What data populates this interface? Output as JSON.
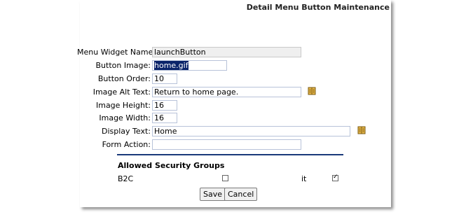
{
  "page_title": "Detail Menu Button Maintenance",
  "fields": {
    "menu_widget_name": {
      "label": "Menu Widget Name:",
      "value": "launchButton"
    },
    "button_image": {
      "label": "Button Image:",
      "value": "home.gif"
    },
    "button_order": {
      "label": "Button Order:",
      "value": "10"
    },
    "image_alt_text": {
      "label": "Image Alt Text:",
      "value": "Return to home page."
    },
    "image_height": {
      "label": "Image Height:",
      "value": "16"
    },
    "image_width": {
      "label": "Image Width:",
      "value": "16"
    },
    "display_text": {
      "label": "Display Text:",
      "value": "Home"
    },
    "form_action": {
      "label": "Form Action:",
      "value": ""
    }
  },
  "security": {
    "heading": "Allowed Security Groups",
    "groups": [
      {
        "name": "B2C",
        "checked": false
      },
      {
        "name": "it",
        "checked": true
      }
    ]
  },
  "buttons": {
    "save": "Save",
    "cancel": "Cancel"
  },
  "icons": {
    "lookup": "book-icon"
  }
}
